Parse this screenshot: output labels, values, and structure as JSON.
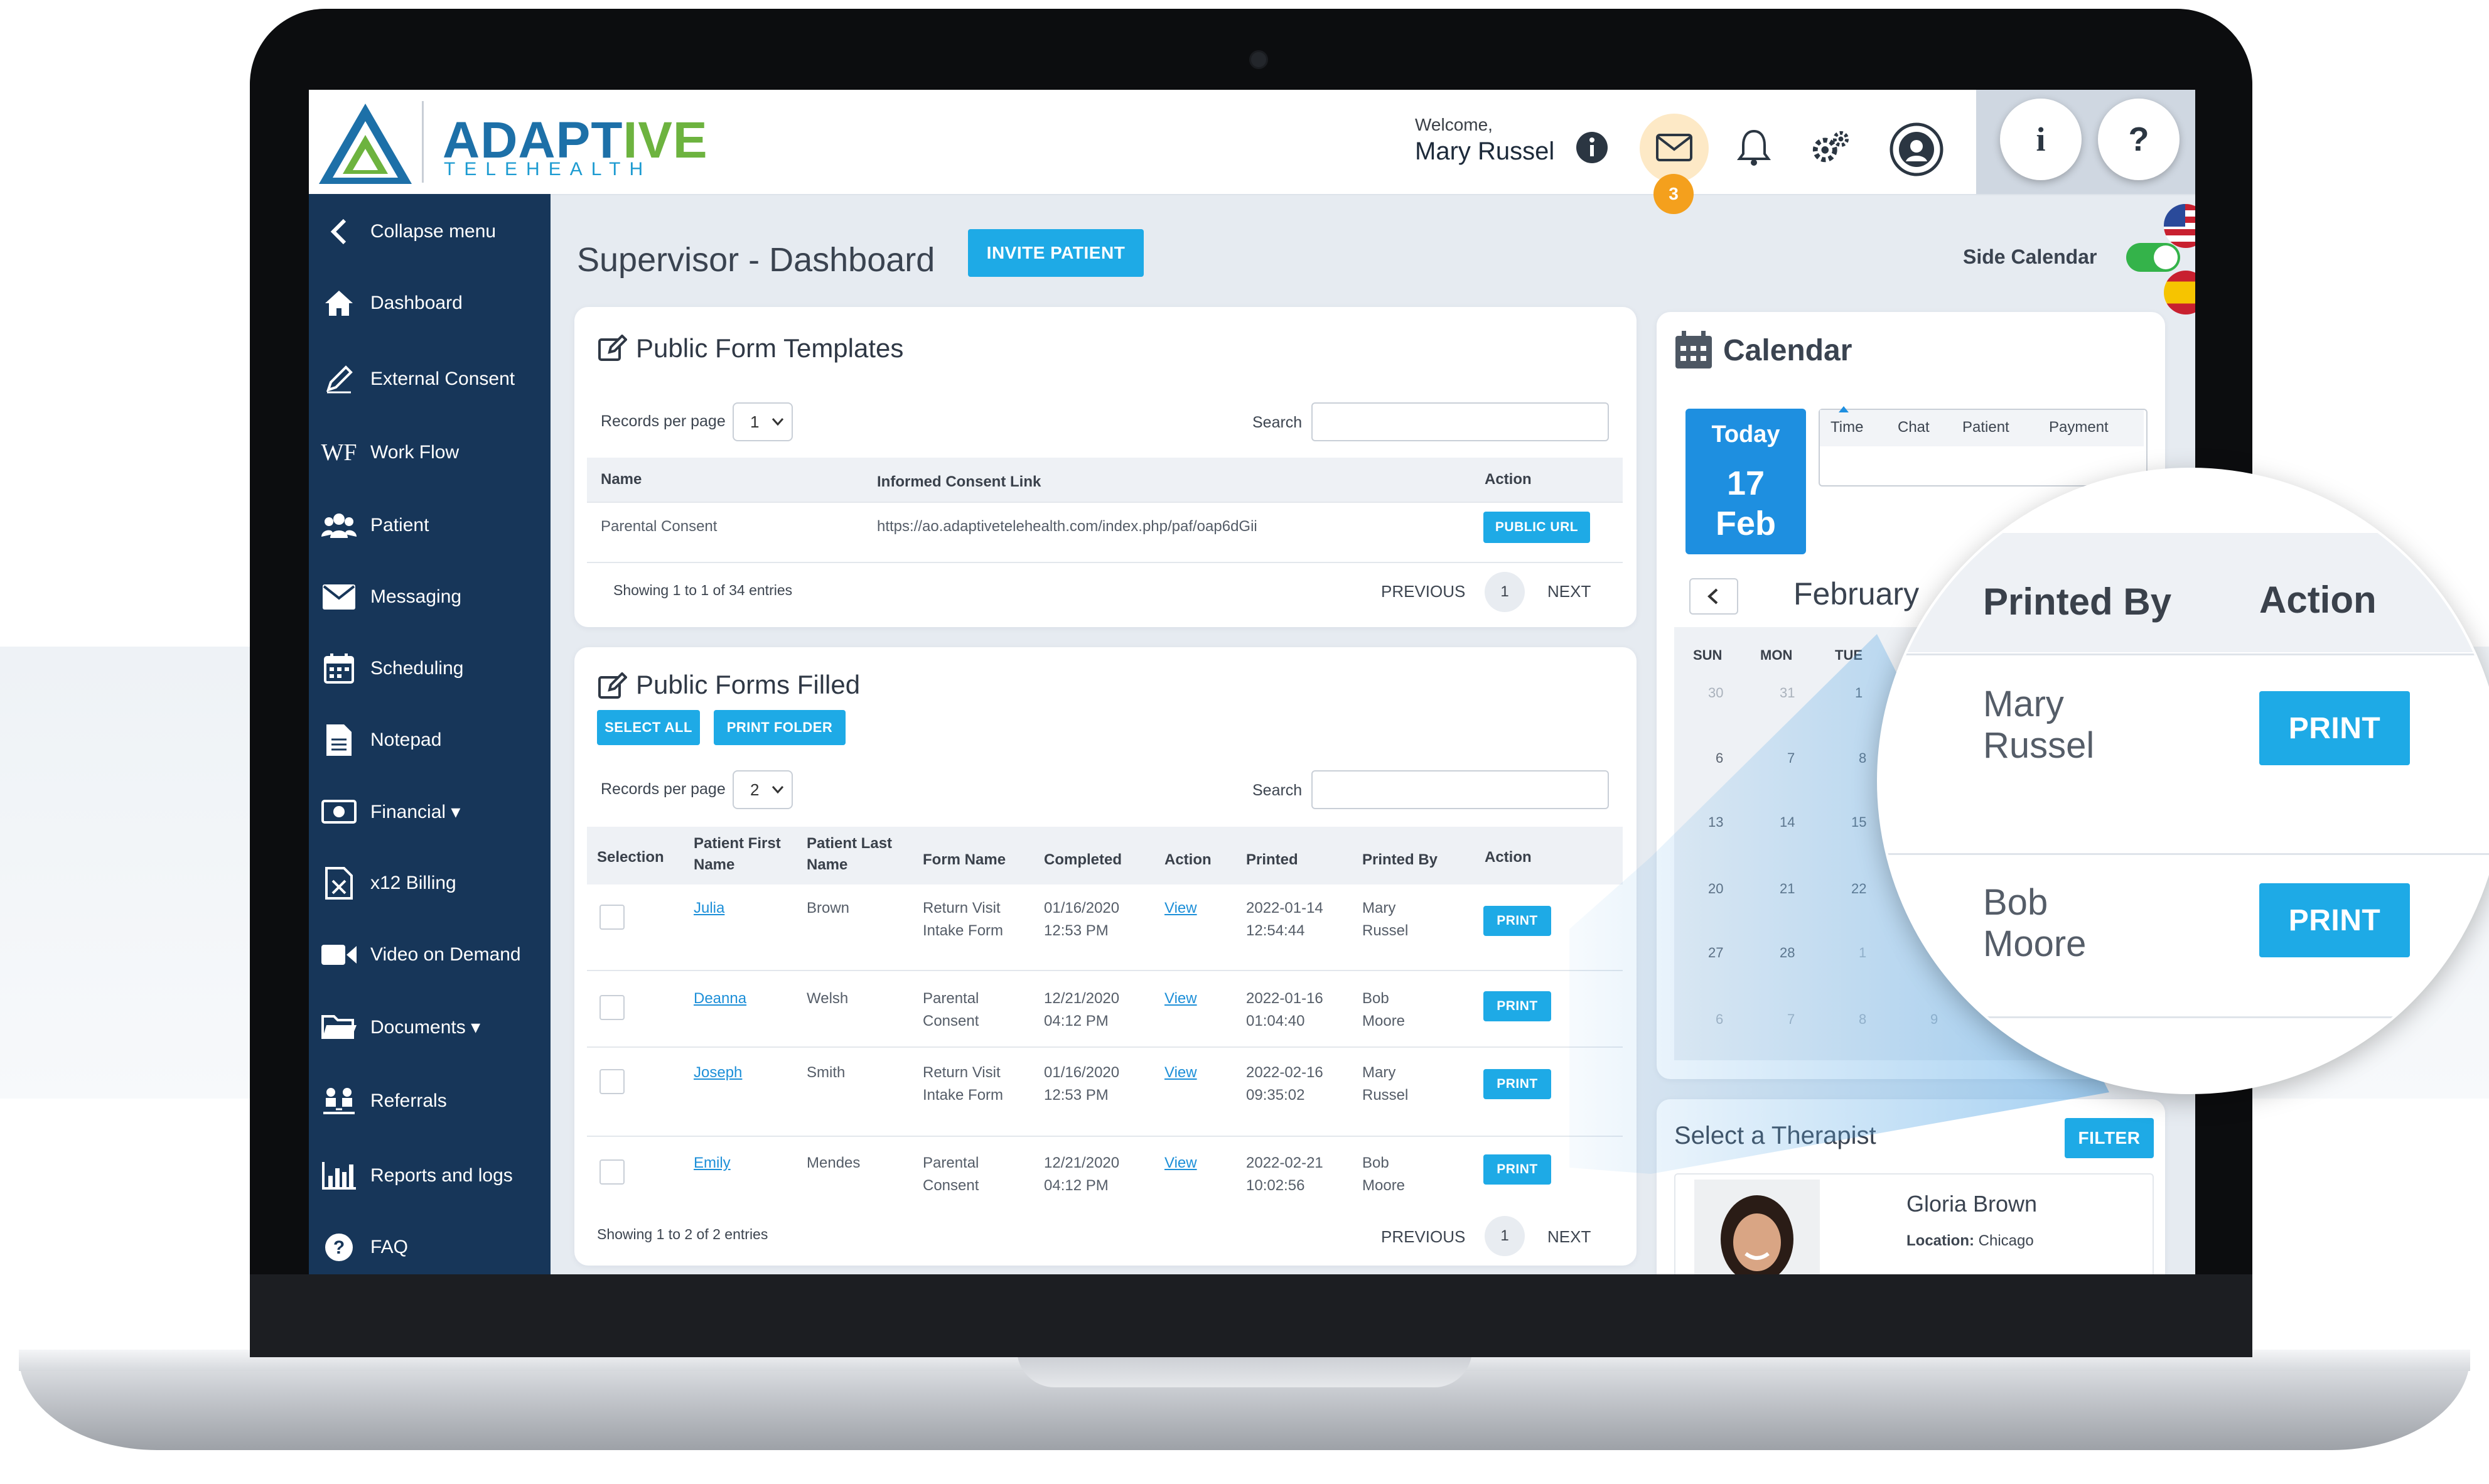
{
  "colors": {
    "sidebar": "#173659",
    "accent": "#1eaae6",
    "brand_blue": "#1d70a8",
    "brand_green": "#6db33f",
    "toggle_on": "#34b34a",
    "badge": "#f4a01d",
    "today": "#1e8fe0"
  },
  "header": {
    "logo_word_a": "ADAPT",
    "logo_word_b": "IVE",
    "logo_sub": "TELEHEALTH",
    "welcome": "Welcome,",
    "user_name": "Mary Russel",
    "mail_badge": "3",
    "info_btn": "i",
    "help_btn": "?"
  },
  "sidebar": {
    "items": [
      {
        "label": "Collapse menu",
        "icon": "chevron-left-icon"
      },
      {
        "label": "Dashboard",
        "icon": "home-icon"
      },
      {
        "label": "External Consent",
        "icon": "pencil-icon"
      },
      {
        "label": "Work Flow",
        "icon": "wf-icon",
        "icon_text": "WF"
      },
      {
        "label": "Patient",
        "icon": "users-icon"
      },
      {
        "label": "Messaging",
        "icon": "envelope-icon"
      },
      {
        "label": "Scheduling",
        "icon": "calendar-icon"
      },
      {
        "label": "Notepad",
        "icon": "file-icon"
      },
      {
        "label": "Financial",
        "icon": "money-icon",
        "caret": "▾"
      },
      {
        "label": "x12 Billing",
        "icon": "excel-file-icon"
      },
      {
        "label": "Video on Demand",
        "icon": "video-icon"
      },
      {
        "label": "Documents",
        "icon": "folder-icon",
        "caret": "▾"
      },
      {
        "label": "Referrals",
        "icon": "referral-icon"
      },
      {
        "label": "Reports and logs",
        "icon": "bar-chart-icon"
      },
      {
        "label": "FAQ",
        "icon": "question-icon"
      }
    ]
  },
  "main": {
    "page_title": "Supervisor - Dashboard",
    "invite_button": "INVITE PATIENT",
    "side_calendar_label": "Side Calendar",
    "templates": {
      "title": "Public Form Templates",
      "records_label": "Records per page",
      "records_value": "1",
      "search_label": "Search",
      "columns": [
        "Name",
        "Informed Consent Link",
        "Action"
      ],
      "rows": [
        {
          "name": "Parental Consent",
          "link": "https://ao.adaptivetelehealth.com/index.php/paf/oap6dGii",
          "action": "PUBLIC URL"
        }
      ],
      "showing": "Showing 1 to 1 of 34 entries",
      "prev": "PREVIOUS",
      "page": "1",
      "next": "NEXT"
    },
    "filled": {
      "title": "Public Forms Filled",
      "select_all": "SELECT ALL",
      "print_folder": "PRINT FOLDER",
      "records_label": "Records per page",
      "records_value": "2",
      "search_label": "Search",
      "columns": [
        "Selection",
        "Patient First Name",
        "Patient Last Name",
        "Form Name",
        "Completed",
        "Action",
        "Printed",
        "Printed By",
        "Action"
      ],
      "col_first_a": "Patient First",
      "col_first_b": "Name",
      "col_last_a": "Patient Last",
      "col_last_b": "Name",
      "rows": [
        {
          "first": "Julia",
          "last": "Brown",
          "form_a": "Return Visit",
          "form_b": "Intake Form",
          "completed_a": "01/16/2020",
          "completed_b": "12:53 PM",
          "view": "View",
          "printed_a": "2022-01-14",
          "printed_b": "12:54:44",
          "by_a": "Mary",
          "by_b": "Russel",
          "action": "PRINT"
        },
        {
          "first": "Deanna",
          "last": "Welsh",
          "form_a": "Parental",
          "form_b": "Consent",
          "completed_a": "12/21/2020",
          "completed_b": "04:12 PM",
          "view": "View",
          "printed_a": "2022-01-16",
          "printed_b": "01:04:40",
          "by_a": "Bob",
          "by_b": "Moore",
          "action": "PRINT"
        },
        {
          "first": "Joseph",
          "last": "Smith",
          "form_a": "Return Visit",
          "form_b": "Intake Form",
          "completed_a": "01/16/2020",
          "completed_b": "12:53 PM",
          "view": "View",
          "printed_a": "2022-02-16",
          "printed_b": "09:35:02",
          "by_a": "Mary",
          "by_b": "Russel",
          "action": "PRINT"
        },
        {
          "first": "Emily",
          "last": "Mendes",
          "form_a": "Parental",
          "form_b": "Consent",
          "completed_a": "12/21/2020",
          "completed_b": "04:12 PM",
          "view": "View",
          "printed_a": "2022-02-21",
          "printed_b": "10:02:56",
          "by_a": "Bob",
          "by_b": "Moore",
          "action": "PRINT"
        }
      ],
      "showing": "Showing 1 to 2 of 2 entries",
      "prev": "PREVIOUS",
      "page": "1",
      "next": "NEXT"
    }
  },
  "calendar": {
    "title": "Calendar",
    "today_label": "Today",
    "today_day": "17",
    "today_month": "Feb",
    "tabs": [
      "Time",
      "Chat",
      "Patient",
      "Payment"
    ],
    "month": "February",
    "weekdays": [
      "SUN",
      "MON",
      "TUE"
    ],
    "rows": [
      [
        "30",
        "31",
        "1"
      ],
      [
        "6",
        "7",
        "8"
      ],
      [
        "13",
        "14",
        "15"
      ],
      [
        "20",
        "21",
        "22"
      ],
      [
        "27",
        "28",
        "1"
      ],
      [
        "6",
        "7",
        "8",
        "9"
      ]
    ]
  },
  "therapist": {
    "title": "Select a Therapist",
    "filter": "FILTER",
    "name": "Gloria Brown",
    "location_label": "Location:",
    "location": "Chicago"
  },
  "magnifier": {
    "col_printed_by": "Printed By",
    "col_action": "Action",
    "rows": [
      {
        "by_a": "Mary",
        "by_b": "Russel",
        "action": "PRINT"
      },
      {
        "by_a": "Bob",
        "by_b": "Moore",
        "action": "PRINT"
      }
    ]
  }
}
